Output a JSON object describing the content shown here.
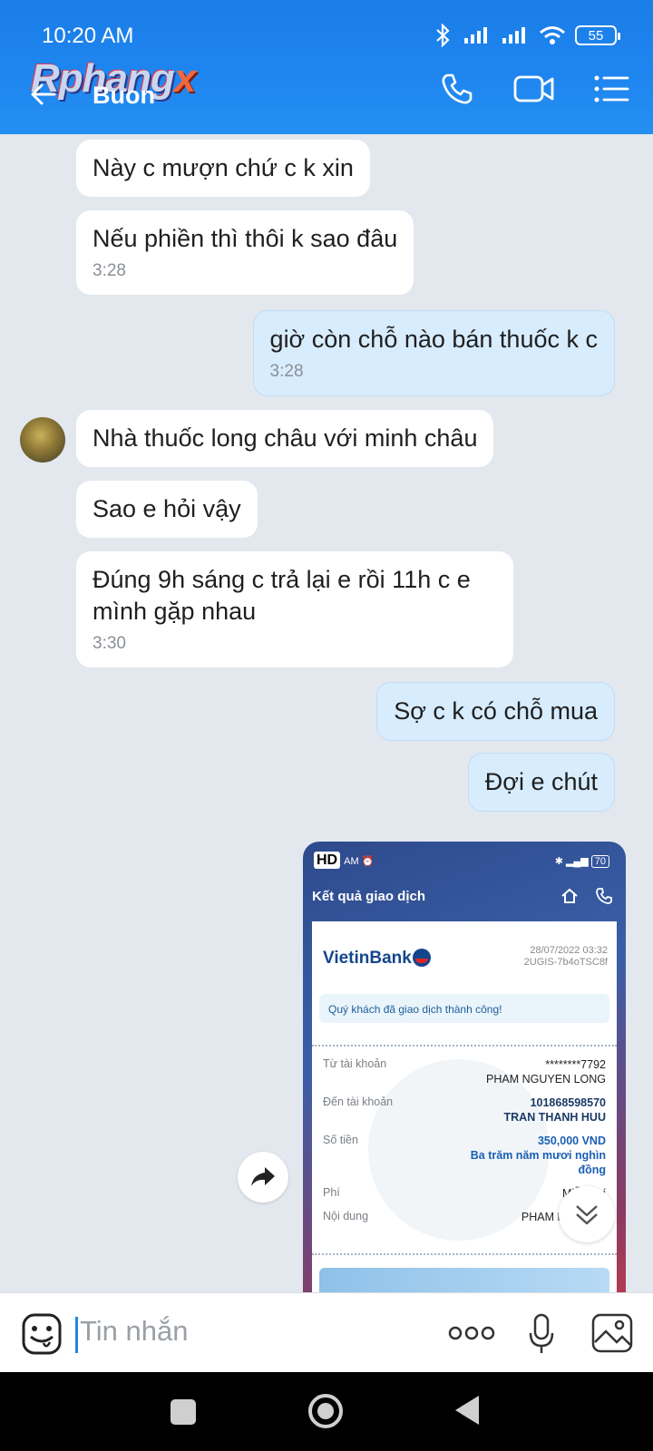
{
  "status_bar": {
    "time": "10:20 AM",
    "battery": "55"
  },
  "header": {
    "logo_main": "Rphang",
    "logo_x": "x",
    "title": "Buon"
  },
  "messages": [
    {
      "dir": "in",
      "text": "Này c mượn chứ c k xin"
    },
    {
      "dir": "in",
      "text": "Nếu phiền thì thôi k sao đâu",
      "time": "3:28"
    },
    {
      "dir": "out",
      "text": "giờ còn chỗ nào bán thuốc k c",
      "time": "3:28"
    },
    {
      "dir": "in",
      "text": "Nhà thuốc long châu với minh châu"
    },
    {
      "dir": "in",
      "text": "Sao e hỏi vậy"
    },
    {
      "dir": "in",
      "text": "Đúng 9h sáng c trả lại e rồi 11h c e mình gặp nhau",
      "time": "3:30"
    },
    {
      "dir": "out",
      "text": "Sợ c k có chỗ mua"
    },
    {
      "dir": "out",
      "text": "Đợi e chút"
    }
  ],
  "receipt": {
    "hd": "HD",
    "am": "AM",
    "battery": "70",
    "title": "Kết quả giao dịch",
    "bank": "VietinBank",
    "date": "28/07/2022 03:32",
    "ref": "2UGIS-7b4oTSC8f",
    "success_msg": "Quý khách đã giao dịch thành công!",
    "from_label": "Từ tài khoản",
    "from_account": "********7792",
    "from_name": "PHAM NGUYEN LONG",
    "to_label": "Đến tài khoản",
    "to_account": "101868598570",
    "to_name": "TRAN THANH HUU",
    "amount_label": "Số tiền",
    "amount": "350,000 VND",
    "amount_words": "Ba trăm năm mươi nghìn đồng",
    "fee_label": "Phí",
    "fee": "Miễn phí",
    "content_label": "Nội dung",
    "content": "PHAM NGUYEN Chuy"
  },
  "composer": {
    "placeholder": "Tin nhắn"
  },
  "colors": {
    "header": "#1f86f0",
    "bubble_out": "#d7ecfd",
    "bubble_in": "#ffffff",
    "chat_bg": "#e2e8ee"
  }
}
